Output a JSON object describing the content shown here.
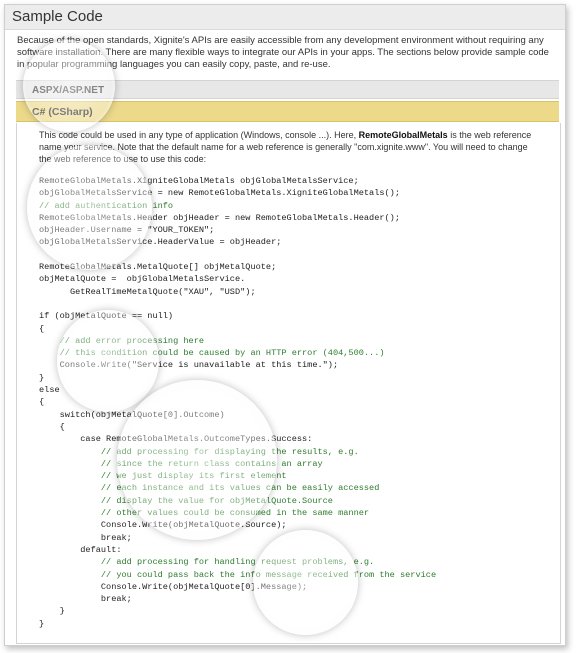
{
  "page": {
    "title": "Sample Code",
    "intro": "Because of the open standards, Xignite's APIs are easily accessible from any development environment without requiring any software installation. There are many flexible ways to integrate our APIs in your apps. The sections below provide sample code in popular programming languages you can easily copy, paste, and re-use."
  },
  "tabs": [
    {
      "label": "ASPX/ASP.NET"
    },
    {
      "label": "C# (CSharp)"
    }
  ],
  "panel": {
    "desc_pre": "This code could be used in any type of application (Windows, console ...). Here, ",
    "desc_bold": "RemoteGlobalMetals",
    "desc_post": " is the web reference name your service. Note that the default name for a web reference is generally \"com.xignite.www\". You will need to change the web reference to use to use this code:",
    "code_lines": [
      {
        "t": "RemoteGlobalMetals.XigniteGlobalMetals objGlobalMetalsService;",
        "c": false
      },
      {
        "t": "objGlobalMetalsService = new RemoteGlobalMetals.XigniteGlobalMetals();",
        "c": false
      },
      {
        "t": "// add authentication info",
        "c": true
      },
      {
        "t": "RemoteGlobalMetals.Header objHeader = new RemoteGlobalMetals.Header();",
        "c": false
      },
      {
        "t": "objHeader.Username = \"YOUR_TOKEN\";",
        "c": false
      },
      {
        "t": "objGlobalMetalsService.HeaderValue = objHeader;",
        "c": false
      },
      {
        "t": "",
        "c": false
      },
      {
        "t": "RemoteGlobalMetals.MetalQuote[] objMetalQuote;",
        "c": false
      },
      {
        "t": "objMetalQuote =  objGlobalMetalsService.",
        "c": false
      },
      {
        "t": "      GetRealTimeMetalQuote(\"XAU\", \"USD\");",
        "c": false
      },
      {
        "t": "",
        "c": false
      },
      {
        "t": "if (objMetalQuote == null)",
        "c": false
      },
      {
        "t": "{",
        "c": false
      },
      {
        "t": "    // add error processing here",
        "c": true
      },
      {
        "t": "    // this condition could be caused by an HTTP error (404,500...)",
        "c": true
      },
      {
        "t": "    Console.Write(\"Service is unavailable at this time.\");",
        "c": false
      },
      {
        "t": "}",
        "c": false
      },
      {
        "t": "else",
        "c": false
      },
      {
        "t": "{",
        "c": false
      },
      {
        "t": "    switch(objMetalQuote[0].Outcome)",
        "c": false
      },
      {
        "t": "    {",
        "c": false
      },
      {
        "t": "        case RemoteGlobalMetals.OutcomeTypes.Success:",
        "c": false
      },
      {
        "t": "            // add processing for displaying the results, e.g.",
        "c": true
      },
      {
        "t": "            // since the return class contains an array",
        "c": true
      },
      {
        "t": "            // we just display its first element",
        "c": true
      },
      {
        "t": "            // each instance and its values can be easily accessed",
        "c": true
      },
      {
        "t": "            // display the value for objMetalQuote.Source",
        "c": true
      },
      {
        "t": "            // other values could be consumed in the same manner",
        "c": true
      },
      {
        "t": "            Console.Write(objMetalQuote.Source);",
        "c": false
      },
      {
        "t": "            break;",
        "c": false
      },
      {
        "t": "        default:",
        "c": false
      },
      {
        "t": "            // add processing for handling request problems, e.g.",
        "c": true
      },
      {
        "t": "            // you could pass back the info message received from the service",
        "c": true
      },
      {
        "t": "            Console.Write(objMetalQuote[0].Message);",
        "c": false
      },
      {
        "t": "            break;",
        "c": false
      },
      {
        "t": "    }",
        "c": false
      },
      {
        "t": "}",
        "c": false
      }
    ]
  }
}
